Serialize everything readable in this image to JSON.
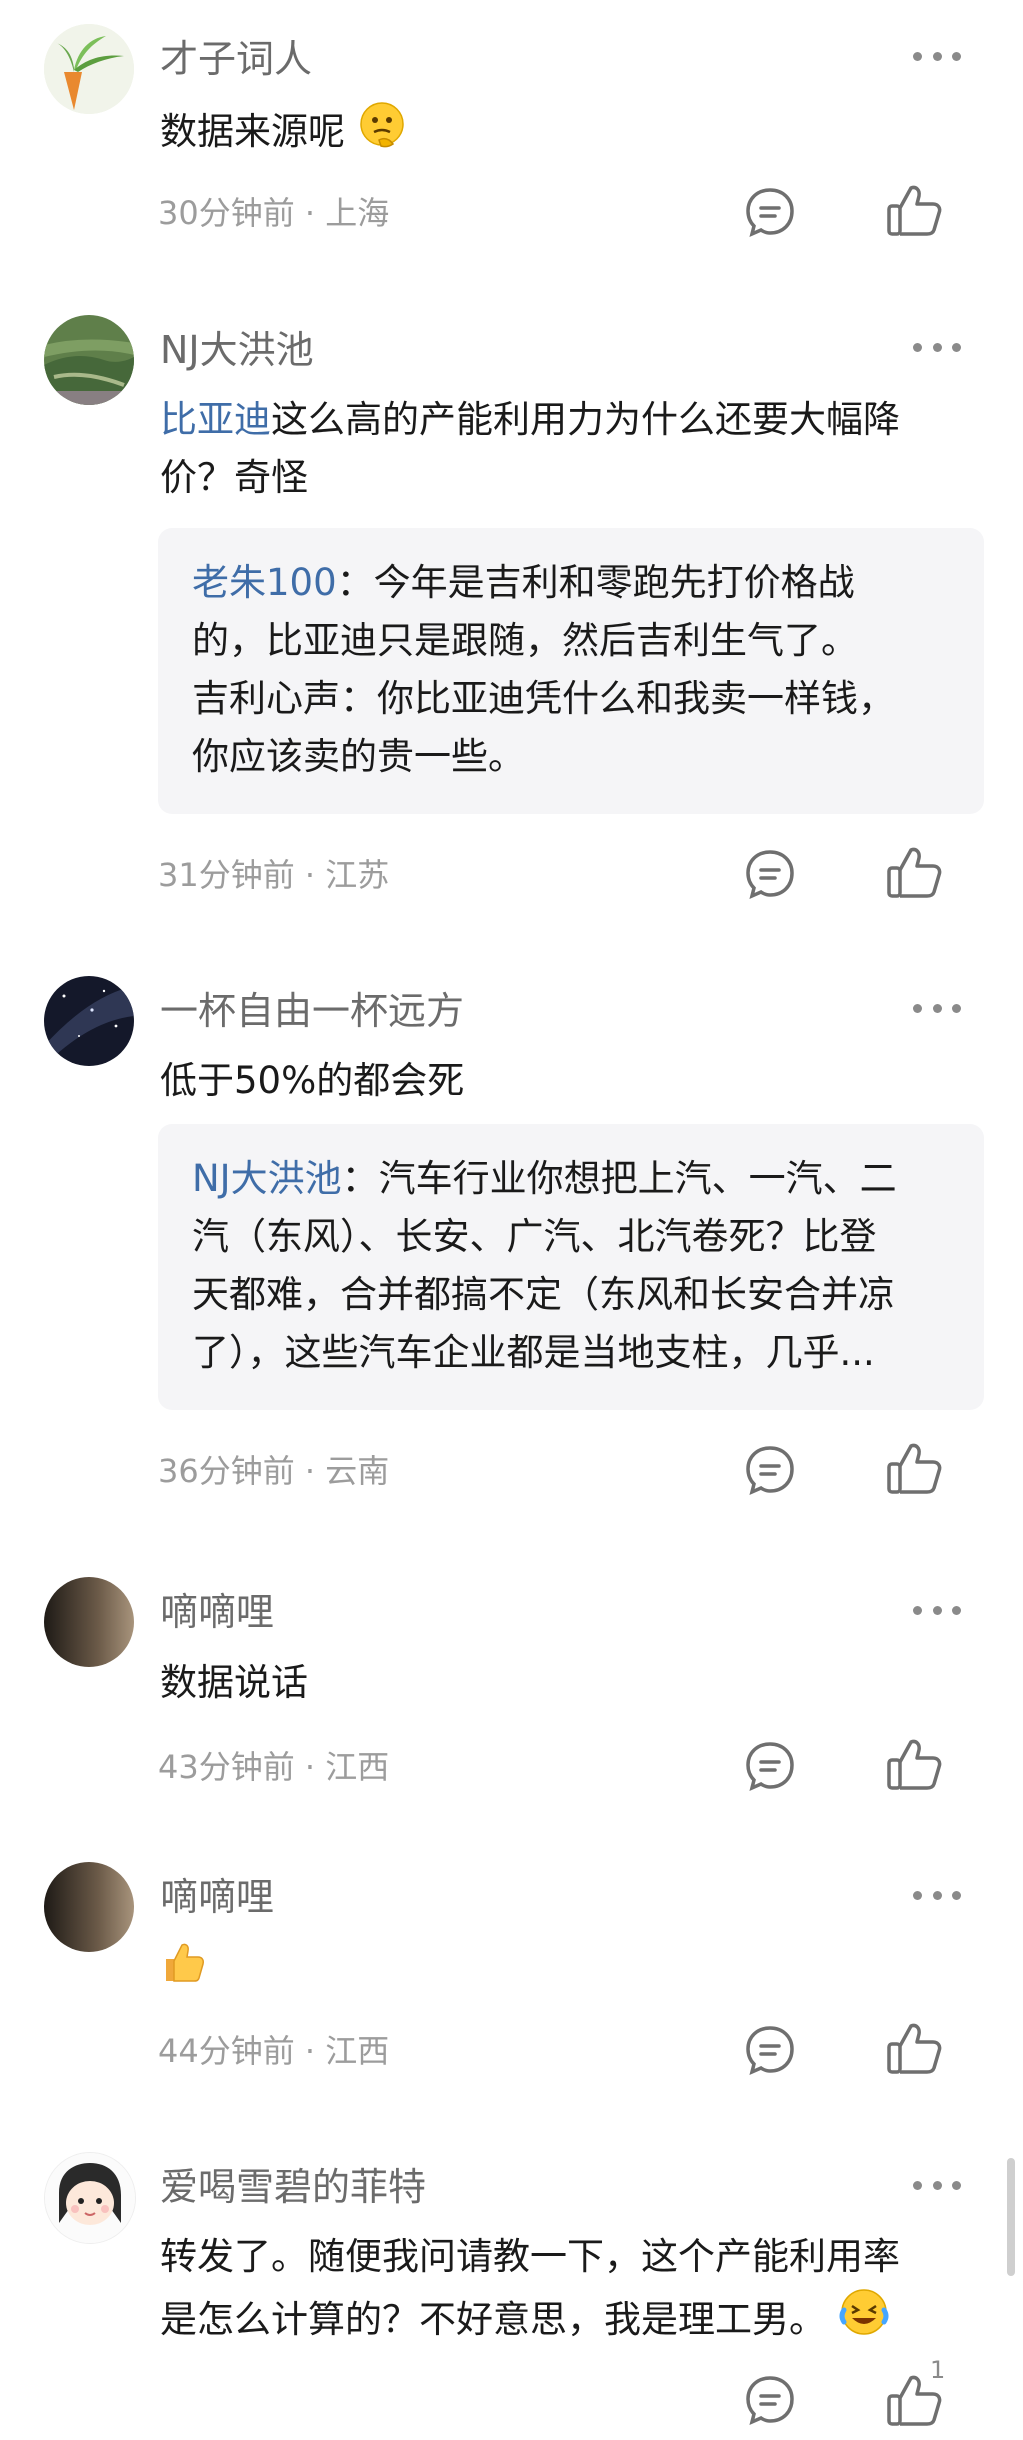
{
  "comments": [
    {
      "username": "才子词人",
      "text": "数据来源呢",
      "emoji": "thinking-face-emoji",
      "time": "30分钟前",
      "location": "上海",
      "avatar": "carrot-plant-icon"
    },
    {
      "username": "NJ大洪池",
      "mention": "比亚迪",
      "text_line1_rest": "这么高的产能利用力为什么还要大幅降",
      "text_line2": "价？奇怪",
      "quote": {
        "name": "老朱100",
        "sep": "：",
        "line1": "今年是吉利和零跑先打价格战",
        "line2": "的，比亚迪只是跟随，然后吉利生气了。",
        "line3": "吉利心声：你比亚迪凭什么和我卖一样钱，",
        "line4": "你应该卖的贵一些。"
      },
      "time": "31分钟前",
      "location": "江苏",
      "avatar": "landscape-photo"
    },
    {
      "username": "一杯自由一杯远方",
      "text": "低于50%的都会死",
      "quote": {
        "name": "NJ大洪池",
        "sep": "：",
        "line1": "汽车行业你想把上汽、一汽、二",
        "line2": "汽（东风）、长安、广汽、北汽卷死？比登",
        "line3": "天都难，合并都搞不定（东风和长安合并凉",
        "line4": "了），这些汽车企业都是当地支柱，几乎..."
      },
      "time": "36分钟前",
      "location": "云南",
      "avatar": "night-sky-photo"
    },
    {
      "username": "嘀嘀哩",
      "text": "数据说话",
      "time": "43分钟前",
      "location": "江西",
      "avatar": "dark-wall-photo"
    },
    {
      "username": "嘀嘀哩",
      "emoji": "thumbs-up-emoji",
      "time": "44分钟前",
      "location": "江西",
      "avatar": "dark-wall-photo"
    },
    {
      "username": "爱喝雪碧的菲特",
      "text_line1": "转发了。随便我问请教一下，这个产能利用率",
      "text_line2": "是怎么计算的？不好意思，我是理工男。",
      "emoji": "laughing-crying-emoji",
      "like_count": "1",
      "avatar": "cartoon-girl-avatar"
    }
  ],
  "meta_separator": "·",
  "colors": {
    "mention": "#3f6da8",
    "username": "#6b6b6b",
    "meta": "#9c9c9c",
    "quote_bg": "#f5f5f7"
  }
}
